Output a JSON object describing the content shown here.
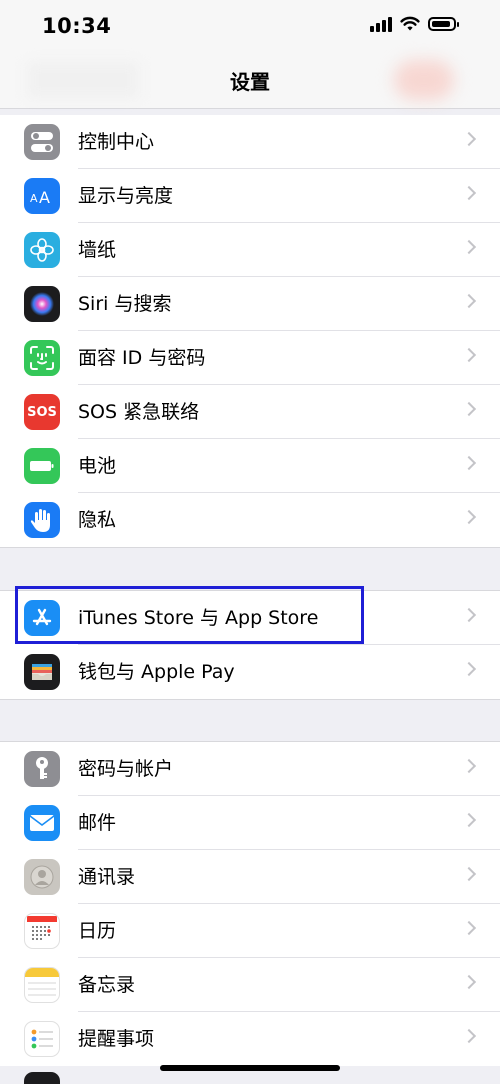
{
  "status_bar": {
    "time": "10:34"
  },
  "nav": {
    "title": "设置"
  },
  "group1": [
    {
      "label": "控制中心",
      "icon": "control-center-icon",
      "color": "#8e8e93"
    },
    {
      "label": "显示与亮度",
      "icon": "display-brightness-icon",
      "color": "#1a7bf5"
    },
    {
      "label": "墙纸",
      "icon": "wallpaper-icon",
      "color": "#2aaee0"
    },
    {
      "label": "Siri 与搜索",
      "icon": "siri-icon",
      "color": "#1c1c1e"
    },
    {
      "label": "面容 ID 与密码",
      "icon": "face-id-icon",
      "color": "#34c759"
    },
    {
      "label": "SOS 紧急联络",
      "icon": "sos-icon",
      "color": "#e8382f"
    },
    {
      "label": "电池",
      "icon": "battery-icon",
      "color": "#34c759"
    },
    {
      "label": "隐私",
      "icon": "privacy-hand-icon",
      "color": "#1a7bf5"
    }
  ],
  "group2": [
    {
      "label": "iTunes Store 与 App Store",
      "icon": "app-store-icon",
      "color": "#1a8ef5"
    },
    {
      "label": "钱包与 Apple Pay",
      "icon": "wallet-icon",
      "color": "#1c1c1e"
    }
  ],
  "group3": [
    {
      "label": "密码与帐户",
      "icon": "key-icon",
      "color": "#8e8e93"
    },
    {
      "label": "邮件",
      "icon": "mail-icon",
      "color": "#1a8ef5"
    },
    {
      "label": "通讯录",
      "icon": "contacts-icon",
      "color": "#c9c6c0"
    },
    {
      "label": "日历",
      "icon": "calendar-icon",
      "color": "#ffffff"
    },
    {
      "label": "备忘录",
      "icon": "notes-icon",
      "color": "#ffffff"
    },
    {
      "label": "提醒事项",
      "icon": "reminders-icon",
      "color": "#ffffff"
    }
  ],
  "icons": {
    "sos_text": "SOS"
  },
  "highlight": {
    "target": "iTunes Store 与 App Store",
    "color": "#1f1fd6"
  }
}
